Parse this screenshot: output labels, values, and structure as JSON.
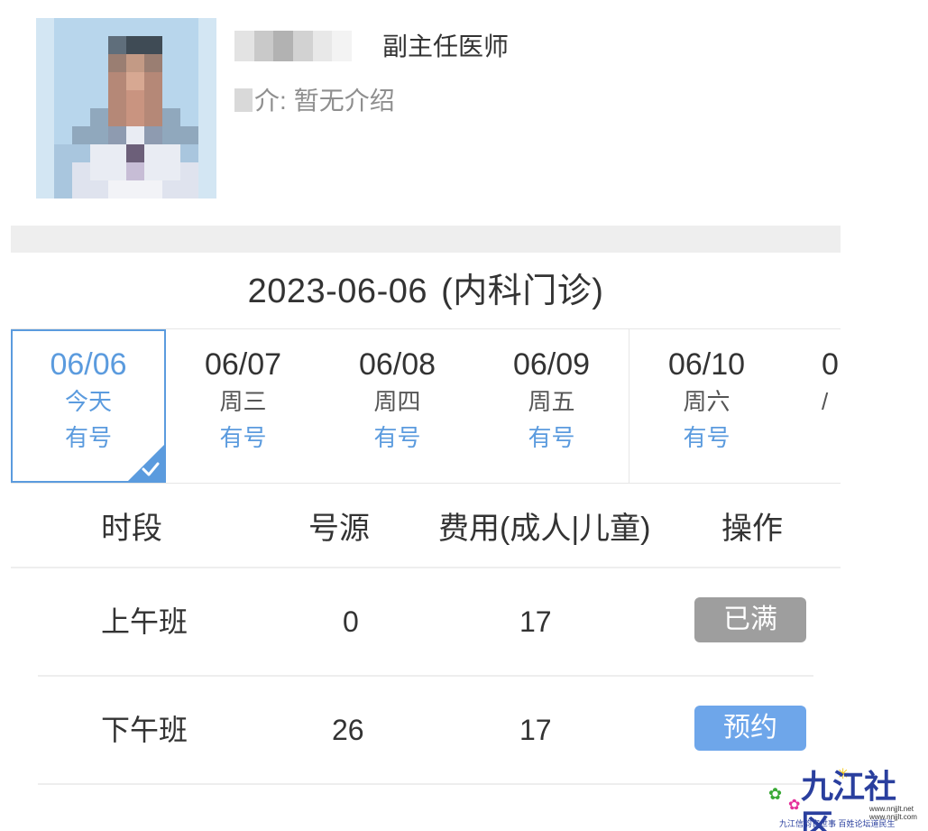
{
  "doctor": {
    "title": "副主任医师",
    "intro_label": "介:",
    "intro_text": "暂无介绍"
  },
  "date_heading": {
    "date": "2023-06-06",
    "clinic": "(内科门诊)"
  },
  "date_tabs": [
    {
      "date": "06/06",
      "weekday": "今天",
      "status": "有号",
      "selected": true
    },
    {
      "date": "06/07",
      "weekday": "周三",
      "status": "有号",
      "selected": false
    },
    {
      "date": "06/08",
      "weekday": "周四",
      "status": "有号",
      "selected": false
    },
    {
      "date": "06/09",
      "weekday": "周五",
      "status": "有号",
      "selected": false
    },
    {
      "date": "06/10",
      "weekday": "周六",
      "status": "有号",
      "selected": false
    },
    {
      "date": "0",
      "weekday": "/",
      "status": "",
      "selected": false
    }
  ],
  "table": {
    "headers": [
      "时段",
      "号源",
      "费用(成人|儿童)",
      "操作"
    ],
    "rows": [
      {
        "period": "上午班",
        "slots": "0",
        "fee": "17",
        "action": "已满",
        "action_state": "full"
      },
      {
        "period": "下午班",
        "slots": "26",
        "fee": "17",
        "action": "预约",
        "action_state": "available"
      }
    ]
  },
  "watermark": {
    "title": "九江社区",
    "url_line1": "www.nnjjlt.net",
    "url_line2": "www.nnjjlt.com",
    "slogan": "九江信韵官世事  百姓论坛道民生"
  },
  "colors": {
    "accent": "#5b9bde",
    "button_available": "#6ea6ea",
    "button_full": "#9e9e9e",
    "divider": "#eeeeee"
  },
  "icons": {
    "selected_check": "check-icon"
  }
}
